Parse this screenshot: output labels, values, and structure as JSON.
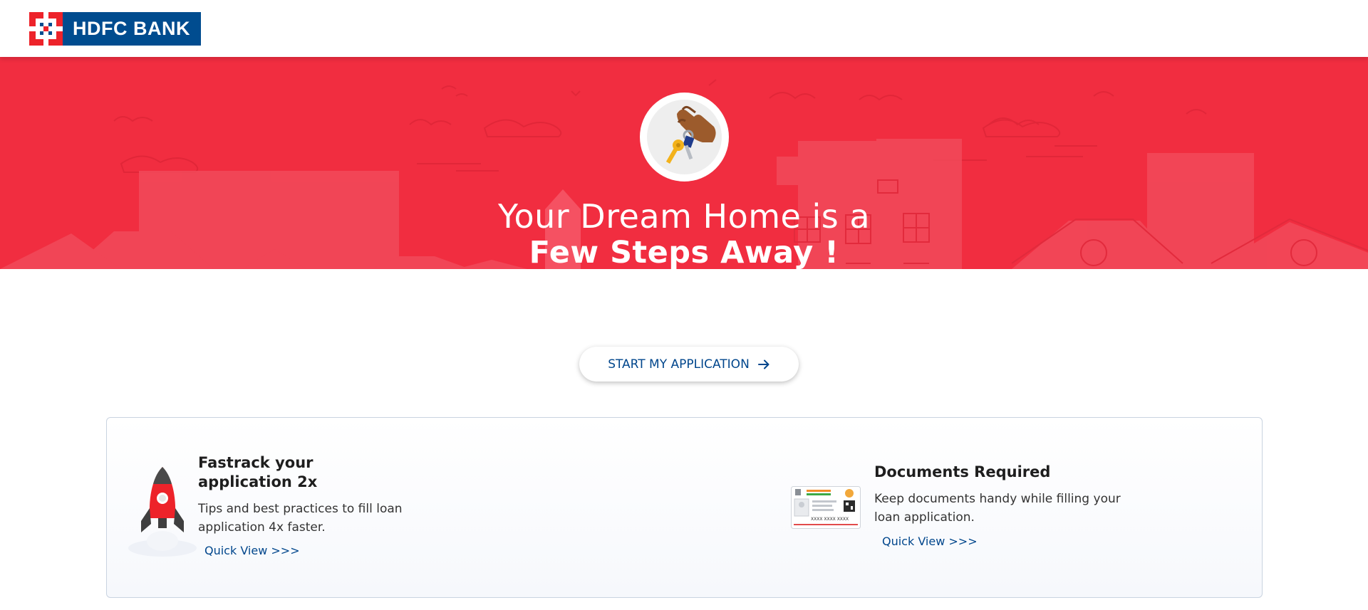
{
  "header": {
    "logo_text": "HDFC BANK",
    "brand_red": "#ed232a",
    "brand_blue": "#004c8f"
  },
  "hero": {
    "title_line1": "Your Dream Home is a",
    "title_line2": "Few Steps Away !",
    "background_color": "#f12d40",
    "badge_icon": "hand-holding-keys-icon"
  },
  "cta": {
    "label": "START MY APPLICATION",
    "icon": "arrow-right-icon",
    "color": "#00468c"
  },
  "info": {
    "fastrack": {
      "icon": "rocket-icon",
      "title": "Fastrack your application 2x",
      "description": "Tips and best practices to fill loan application 4x faster.",
      "link": "Quick View >>>"
    },
    "documents": {
      "icon": "id-card-icon",
      "title": "Documents Required",
      "description": "Keep documents handy while filling your loan application.",
      "link": "Quick View >>>",
      "card_text": "XXXX XXXX XXXX"
    }
  }
}
